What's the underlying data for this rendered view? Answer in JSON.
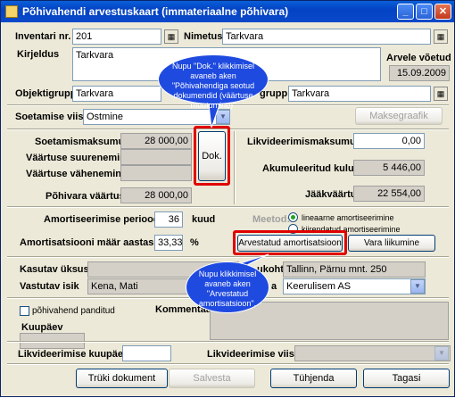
{
  "window": {
    "title": "Põhivahendi arvestuskaart (immateriaalne põhivara)"
  },
  "fields": {
    "inventari_label": "Inventari nr.",
    "inventari_value": "201",
    "nimetus_label": "Nimetus",
    "nimetus_value": "Tarkvara",
    "kirjeldus_label": "Kirjeldus",
    "kirjeldus_value": "Tarkvara",
    "arvele_label": "Arvele võetud",
    "arvele_value": "15.09.2009",
    "objektigrupp_label": "Objektigrupp",
    "objektigrupp_value": "Tarkvara",
    "grupp_label": "grupp",
    "grupp_value": "Tarkvara",
    "soetamise_label": "Soetamise viis:",
    "soetamise_value": "Ostmine",
    "makse_button": "Maksegraafik",
    "soetamismaksumus_label": "Soetamismaksumus",
    "soetamismaksumus_value": "28 000,00",
    "suurenemine_label": "Väärtuse suurenemine",
    "vahenemine_label": "Väärtuse vähenemine",
    "pohivara_label": "Põhivara väärtus",
    "pohivara_value": "28 000,00",
    "dok_button": "Dok.",
    "likv_maksumus_label": "Likvideerimismaksumus",
    "likv_maksumus_value": "0,00",
    "akum_label": "Akumuleeritud kulum",
    "akum_value": "5 446,00",
    "jaak_label": "Jääkväärtus",
    "jaak_value": "22 554,00",
    "periood_label": "Amortiseerimise periood",
    "periood_value": "36",
    "periood_unit": "kuud",
    "maar_label": "Amortisatsiooni määr aastas",
    "maar_value": "33,33",
    "maar_unit": "%",
    "meetod_label": "Meetod:",
    "meetod_opt1": "lineaarne amortiseerimine",
    "meetod_opt2": "kiirendatud amortiseerimine",
    "arvestatud_button": "Arvestatud amortisatsioon",
    "vara_button": "Vara liikumine",
    "kasutav_label": "Kasutav üksus",
    "vastutav_label": "Vastutav isik",
    "vastutav_value": "Kena, Mati",
    "asukoht_label": "ukoht",
    "asukoht_value": "Tallinn, Pärnu mnt. 250",
    "ettevote_label": "a",
    "ettevote_value": "Keerulisem AS",
    "pandi_label": "põhivahend panditud",
    "kuupaev_label": "Kuupäev",
    "kommentaar_label": "Kommentaar",
    "likv_kuupaev_label": "Likvideerimise kuupäev",
    "likv_viis_label": "Likvideerimise viis"
  },
  "callouts": {
    "dok": "Nupu \"Dok.\" klikkimisel avaneb aken \"Põhivahendiga seotud dokumendid (väärtuse muutumine)\"",
    "arvestatud": "Nupu klikkimisel avaneb aken \"Arvestatud amortisatsioon\"."
  },
  "footer": {
    "print": "Trüki dokument",
    "save": "Salvesta",
    "clear": "Tühjenda",
    "back": "Tagasi"
  }
}
